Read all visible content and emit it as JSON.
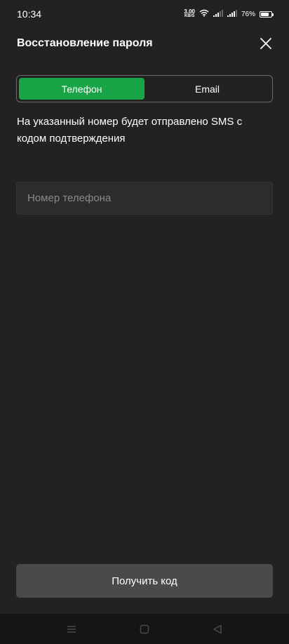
{
  "status_bar": {
    "time": "10:34",
    "net_speed_value": "3.00",
    "net_speed_unit": "KB/S",
    "battery_percent": "76%",
    "battery_level": 0.76
  },
  "header": {
    "title": "Восстановление пароля"
  },
  "tabs": [
    {
      "label": "Телефон",
      "active": true
    },
    {
      "label": "Email",
      "active": false
    }
  ],
  "description": "На указанный номер будет отправлено SMS с кодом подтверждения",
  "phone_input": {
    "value": "",
    "placeholder": "Номер телефона"
  },
  "submit_button": {
    "label": "Получить код"
  },
  "colors": {
    "background": "#222222",
    "accent": "#19a448",
    "button": "#4a4a4a",
    "input": "#2c2c2c",
    "nav_bar": "#151515"
  },
  "icons": {
    "close": "close-icon",
    "wifi": "wifi-icon",
    "signal": "signal-icon",
    "battery": "battery-icon",
    "nav_menu": "menu-icon",
    "nav_home": "home-icon",
    "nav_back": "back-icon"
  }
}
